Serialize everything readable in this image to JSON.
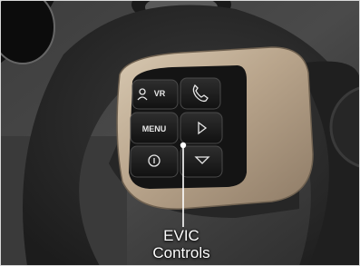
{
  "callout": {
    "line1": "EVIC",
    "line2": "Controls"
  },
  "buttons": {
    "voice_label": "VR",
    "menu_label": "MENU"
  },
  "icons": {
    "voice": "voice-recognition-icon",
    "phone": "phone-icon",
    "play": "right-arrow-icon",
    "down": "down-arrow-icon",
    "info": "info-circle-icon"
  },
  "colors": {
    "bezel": "#b9a58c",
    "button": "#1c1c1c",
    "wheel": "#2e2e2e",
    "callout_text": "#ffffff"
  }
}
